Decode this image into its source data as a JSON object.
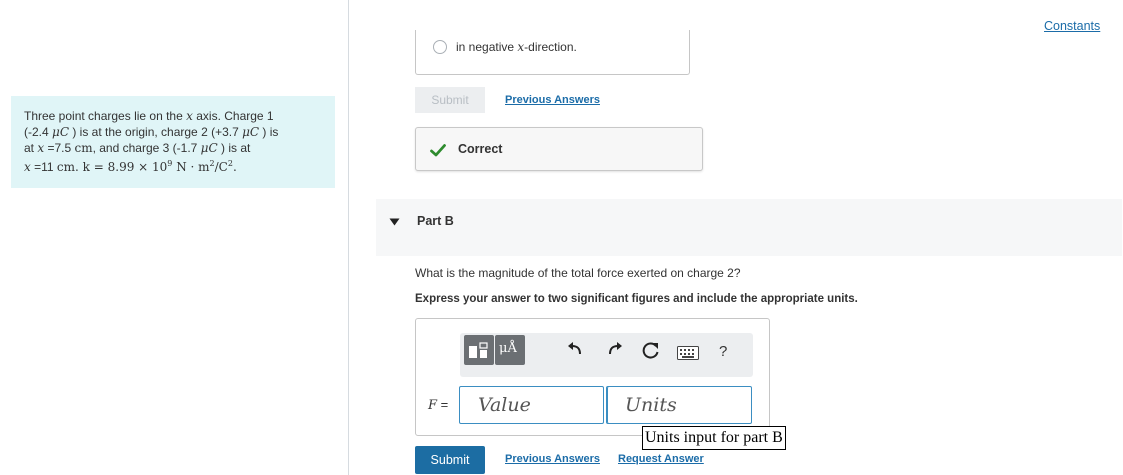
{
  "problem": {
    "text_line1_pre": "Three point charges lie on the ",
    "x_symbol": "x",
    "text_line1_post": " axis. Charge 1",
    "q1_value": "(-2.4 ",
    "unit_microcoulomb": "μC",
    "q1_post": " ) is at the origin, charge 2 (+3.7 ",
    "q2_post": " ) is",
    "line3_pre": "at ",
    "x2_value": " =7.5 ",
    "cm": "cm",
    "line3_mid": ", and charge 3 (-1.7 ",
    "line3_post": " ) is at",
    "x3_value": " =11 ",
    "k_text": ". k = 8.99 × 10",
    "k_exp": "9",
    "k_units": " N · m",
    "sq": "2",
    "k_tail": "/C",
    "period": "."
  },
  "constants_link": "Constants",
  "part_a": {
    "option_pre": "in negative ",
    "option_var": "x",
    "option_post": "-direction.",
    "submit_label": "Submit",
    "previous_answers": "Previous Answers",
    "feedback": "Correct"
  },
  "part_b": {
    "title": "Part B",
    "question": "What is the magnitude of the total force exerted on charge 2?",
    "instruction": "Express your answer to two significant figures and include the appropriate units.",
    "toolbar": {
      "units_label": "μÅ",
      "help_label": "?"
    },
    "variable": "F",
    "equals": " =",
    "value_placeholder": "Value",
    "units_placeholder": "Units",
    "units_tooltip": "Units input for part B",
    "submit_label": "Submit",
    "previous_answers": "Previous Answers",
    "request_answer": "Request Answer"
  },
  "colors": {
    "accent": "#1c6da3",
    "link": "#1b6ca8",
    "correct_green": "#2e8b2e",
    "problem_bg": "#e0f5f7"
  }
}
